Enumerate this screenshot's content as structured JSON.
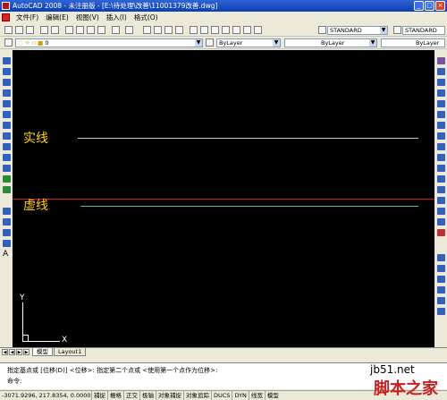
{
  "window": {
    "title": "AutoCAD 2008 - 未注册版 - [E:\\待处理\\改善\\11001379改善.dwg]",
    "min": "_",
    "max": "□",
    "close": "×"
  },
  "menu": {
    "items": [
      "文件(F)",
      "编辑(E)",
      "视图(V)",
      "插入(I)",
      "格式(O)"
    ]
  },
  "toolbar": {
    "text_style": "STANDARD",
    "dim_style": "STANDARD",
    "layer": "0",
    "color": "ByLayer",
    "linetype": "ByLayer",
    "lineweight": "ByLayer"
  },
  "canvas": {
    "label_solid": "实线",
    "label_dashed": "虚线",
    "ucs_x": "X",
    "ucs_y": "Y"
  },
  "tabs": {
    "nav": [
      "◀",
      "◀",
      "▶",
      "▶"
    ],
    "model": "模型",
    "layout1": "Layout1"
  },
  "command": {
    "line1": "指定基点或 [位移(D)] <位移>:  指定第二个点或 <使用第一个点作为位移>:",
    "line2": "命令:"
  },
  "status": {
    "coords": "-3071.9296, 217.8354, 0.0000",
    "buttons": [
      "捕捉",
      "栅格",
      "正交",
      "极轴",
      "对象捕捉",
      "对象追踪",
      "DUCS",
      "DYN",
      "线宽",
      "模型"
    ]
  },
  "watermark": {
    "site": "jb51.net",
    "brand": "脚本之家"
  },
  "colors": {
    "canvas_bg": "#000000",
    "label": "#ffd400",
    "solid_line": "#c8c8c8",
    "dashed_line": "#40c0b0",
    "red_line": "#d01818"
  }
}
